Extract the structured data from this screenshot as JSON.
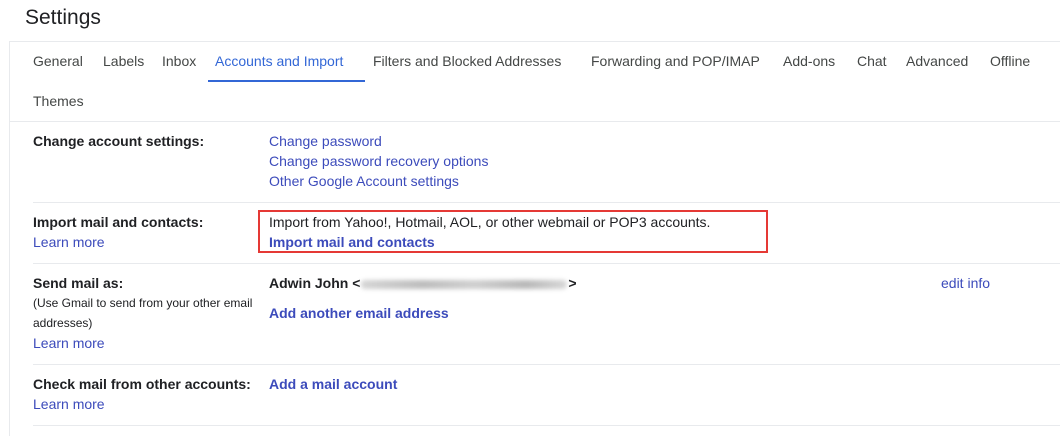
{
  "page": {
    "title": "Settings"
  },
  "tabs": [
    {
      "label": "General"
    },
    {
      "label": "Labels"
    },
    {
      "label": "Inbox"
    },
    {
      "label": "Accounts and Import",
      "active": true
    },
    {
      "label": "Filters and Blocked Addresses"
    },
    {
      "label": "Forwarding and POP/IMAP"
    },
    {
      "label": "Add-ons"
    },
    {
      "label": "Chat"
    },
    {
      "label": "Advanced"
    },
    {
      "label": "Offline"
    },
    {
      "label": "Themes"
    }
  ],
  "colors": {
    "accent": "#3367d6",
    "link": "#3c4bbb",
    "highlight_box": "#e53935"
  },
  "sections": {
    "change_account": {
      "label": "Change account settings:",
      "links": [
        "Change password",
        "Change password recovery options",
        "Other Google Account settings"
      ]
    },
    "import_mail": {
      "label": "Import mail and contacts:",
      "learn_more": "Learn more",
      "description": "Import from Yahoo!, Hotmail, AOL, or other webmail or POP3 accounts.",
      "action": "Import mail and contacts"
    },
    "send_mail": {
      "label": "Send mail as:",
      "help": "(Use Gmail to send from your other email addresses)",
      "learn_more": "Learn more",
      "sender_name": "Adwin John <",
      "sender_end": ">",
      "edit": "edit info",
      "add": "Add another email address"
    },
    "check_mail": {
      "label": "Check mail from other accounts:",
      "learn_more": "Learn more",
      "add": "Add a mail account"
    }
  }
}
